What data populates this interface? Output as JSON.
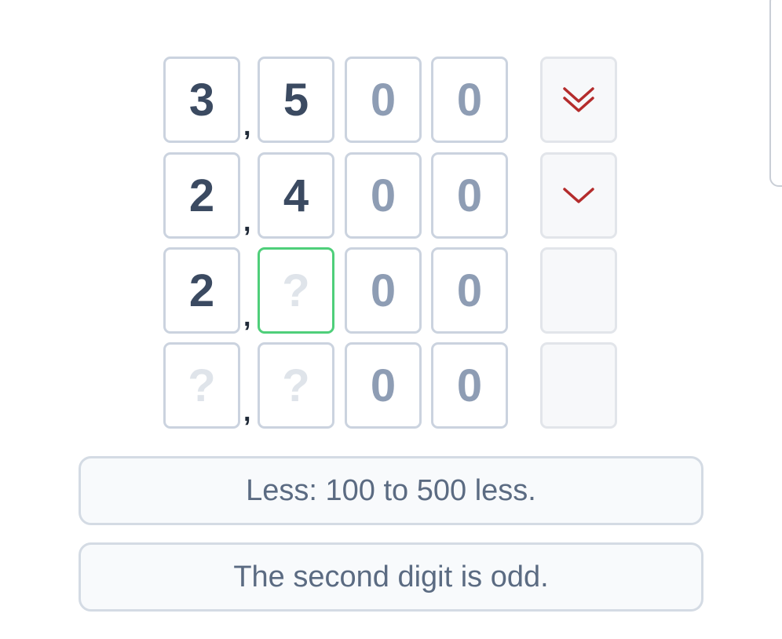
{
  "rows": [
    {
      "digits": [
        "3",
        "5",
        "0",
        "0"
      ],
      "separator": ",",
      "hint_icon": "double-chevron-down-icon"
    },
    {
      "digits": [
        "2",
        "4",
        "0",
        "0"
      ],
      "separator": ",",
      "hint_icon": "chevron-down-icon"
    },
    {
      "digits": [
        "2",
        "?",
        "0",
        "0"
      ],
      "separator": ",",
      "hint_icon": ""
    },
    {
      "digits": [
        "?",
        "?",
        "0",
        "0"
      ],
      "separator": ",",
      "hint_icon": ""
    }
  ],
  "clues": [
    "Less: 100 to 500 less.",
    "The second digit is odd."
  ],
  "colors": {
    "hint_red": "#b42c2c",
    "active_border": "#4fcf7a",
    "digit": "#3b4a61",
    "zero_digit": "#8e9db4",
    "unknown_digit": "#dfe4ea"
  }
}
